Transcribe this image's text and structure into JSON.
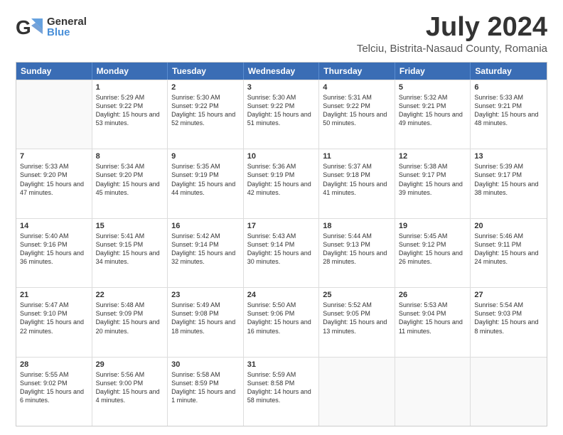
{
  "header": {
    "logo": {
      "line1": "General",
      "line2": "Blue"
    },
    "title": "July 2024",
    "location": "Telciu, Bistrita-Nasaud County, Romania"
  },
  "calendar": {
    "days": [
      "Sunday",
      "Monday",
      "Tuesday",
      "Wednesday",
      "Thursday",
      "Friday",
      "Saturday"
    ],
    "weeks": [
      [
        {
          "day": "",
          "empty": true
        },
        {
          "day": "1",
          "sunrise": "5:29 AM",
          "sunset": "9:22 PM",
          "daylight": "15 hours and 53 minutes."
        },
        {
          "day": "2",
          "sunrise": "5:30 AM",
          "sunset": "9:22 PM",
          "daylight": "15 hours and 52 minutes."
        },
        {
          "day": "3",
          "sunrise": "5:30 AM",
          "sunset": "9:22 PM",
          "daylight": "15 hours and 51 minutes."
        },
        {
          "day": "4",
          "sunrise": "5:31 AM",
          "sunset": "9:22 PM",
          "daylight": "15 hours and 50 minutes."
        },
        {
          "day": "5",
          "sunrise": "5:32 AM",
          "sunset": "9:21 PM",
          "daylight": "15 hours and 49 minutes."
        },
        {
          "day": "6",
          "sunrise": "5:33 AM",
          "sunset": "9:21 PM",
          "daylight": "15 hours and 48 minutes."
        }
      ],
      [
        {
          "day": "7",
          "sunrise": "5:33 AM",
          "sunset": "9:20 PM",
          "daylight": "15 hours and 47 minutes."
        },
        {
          "day": "8",
          "sunrise": "5:34 AM",
          "sunset": "9:20 PM",
          "daylight": "15 hours and 45 minutes."
        },
        {
          "day": "9",
          "sunrise": "5:35 AM",
          "sunset": "9:19 PM",
          "daylight": "15 hours and 44 minutes."
        },
        {
          "day": "10",
          "sunrise": "5:36 AM",
          "sunset": "9:19 PM",
          "daylight": "15 hours and 42 minutes."
        },
        {
          "day": "11",
          "sunrise": "5:37 AM",
          "sunset": "9:18 PM",
          "daylight": "15 hours and 41 minutes."
        },
        {
          "day": "12",
          "sunrise": "5:38 AM",
          "sunset": "9:17 PM",
          "daylight": "15 hours and 39 minutes."
        },
        {
          "day": "13",
          "sunrise": "5:39 AM",
          "sunset": "9:17 PM",
          "daylight": "15 hours and 38 minutes."
        }
      ],
      [
        {
          "day": "14",
          "sunrise": "5:40 AM",
          "sunset": "9:16 PM",
          "daylight": "15 hours and 36 minutes."
        },
        {
          "day": "15",
          "sunrise": "5:41 AM",
          "sunset": "9:15 PM",
          "daylight": "15 hours and 34 minutes."
        },
        {
          "day": "16",
          "sunrise": "5:42 AM",
          "sunset": "9:14 PM",
          "daylight": "15 hours and 32 minutes."
        },
        {
          "day": "17",
          "sunrise": "5:43 AM",
          "sunset": "9:14 PM",
          "daylight": "15 hours and 30 minutes."
        },
        {
          "day": "18",
          "sunrise": "5:44 AM",
          "sunset": "9:13 PM",
          "daylight": "15 hours and 28 minutes."
        },
        {
          "day": "19",
          "sunrise": "5:45 AM",
          "sunset": "9:12 PM",
          "daylight": "15 hours and 26 minutes."
        },
        {
          "day": "20",
          "sunrise": "5:46 AM",
          "sunset": "9:11 PM",
          "daylight": "15 hours and 24 minutes."
        }
      ],
      [
        {
          "day": "21",
          "sunrise": "5:47 AM",
          "sunset": "9:10 PM",
          "daylight": "15 hours and 22 minutes."
        },
        {
          "day": "22",
          "sunrise": "5:48 AM",
          "sunset": "9:09 PM",
          "daylight": "15 hours and 20 minutes."
        },
        {
          "day": "23",
          "sunrise": "5:49 AM",
          "sunset": "9:08 PM",
          "daylight": "15 hours and 18 minutes."
        },
        {
          "day": "24",
          "sunrise": "5:50 AM",
          "sunset": "9:06 PM",
          "daylight": "15 hours and 16 minutes."
        },
        {
          "day": "25",
          "sunrise": "5:52 AM",
          "sunset": "9:05 PM",
          "daylight": "15 hours and 13 minutes."
        },
        {
          "day": "26",
          "sunrise": "5:53 AM",
          "sunset": "9:04 PM",
          "daylight": "15 hours and 11 minutes."
        },
        {
          "day": "27",
          "sunrise": "5:54 AM",
          "sunset": "9:03 PM",
          "daylight": "15 hours and 8 minutes."
        }
      ],
      [
        {
          "day": "28",
          "sunrise": "5:55 AM",
          "sunset": "9:02 PM",
          "daylight": "15 hours and 6 minutes."
        },
        {
          "day": "29",
          "sunrise": "5:56 AM",
          "sunset": "9:00 PM",
          "daylight": "15 hours and 4 minutes."
        },
        {
          "day": "30",
          "sunrise": "5:58 AM",
          "sunset": "8:59 PM",
          "daylight": "15 hours and 1 minute."
        },
        {
          "day": "31",
          "sunrise": "5:59 AM",
          "sunset": "8:58 PM",
          "daylight": "14 hours and 58 minutes."
        },
        {
          "day": "",
          "empty": true
        },
        {
          "day": "",
          "empty": true
        },
        {
          "day": "",
          "empty": true
        }
      ]
    ]
  }
}
